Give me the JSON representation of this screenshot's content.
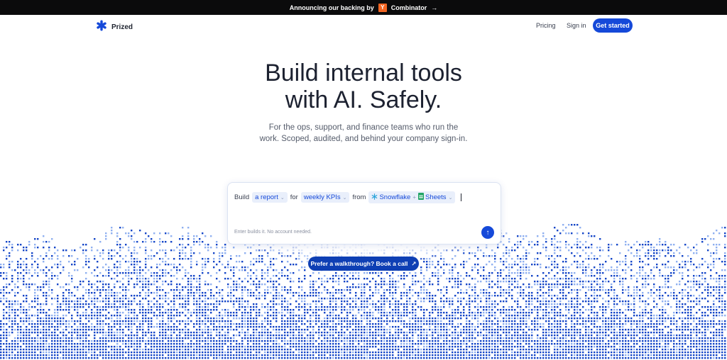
{
  "banner": {
    "text": "Announcing our backing by",
    "yc_letter": "Y",
    "yc_word": "Combinator",
    "arrow": "→"
  },
  "nav": {
    "brand": "Prized",
    "pricing": "Pricing",
    "signin": "Sign in",
    "cta": "Get started"
  },
  "hero": {
    "title_line1": "Build internal tools",
    "title_line2": "with AI. Safely.",
    "sub_line1": "For the ops, support, and finance teams who run the",
    "sub_line2": "work. Scoped, audited, and behind your company sign-in."
  },
  "prompt": {
    "word_build": "Build",
    "chip_output": "a report",
    "word_for": "for",
    "chip_topic": "weekly KPIs",
    "word_from": "from",
    "source_1": "Snowflake",
    "plus": "+",
    "source_2": "Sheets",
    "caret": "⌄",
    "hint": "Enter builds it. No account needed.",
    "send_arrow": "↑"
  },
  "walkthrough": {
    "label": "Prefer a walkthrough? Book a call",
    "arrow": "↗"
  },
  "colors": {
    "accent": "#1549d9",
    "dots_light": "#8fb0f0",
    "dots_dark": "#1546c8",
    "banner_bg": "#0b0b0c",
    "yc_orange": "#f26522"
  },
  "icons": {
    "logo": "asterisk-logo-icon",
    "snowflake": "snowflake-icon",
    "sheets": "sheets-icon",
    "send": "arrow-up-icon",
    "external": "arrow-up-right-icon"
  }
}
